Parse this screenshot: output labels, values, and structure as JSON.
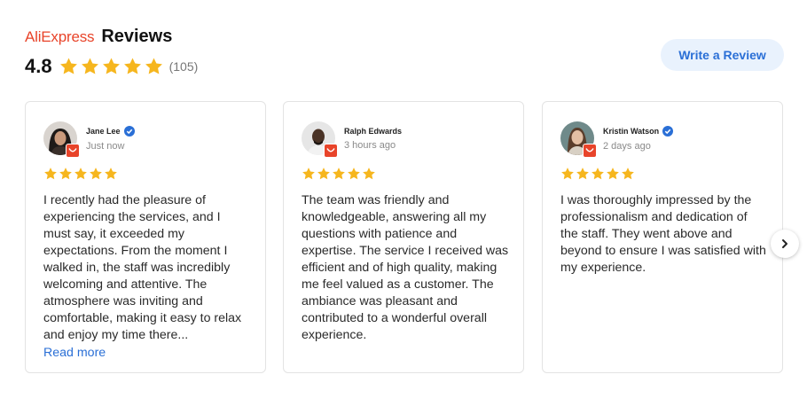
{
  "header": {
    "brand": "AliExpress",
    "title": "Reviews",
    "average_rating": "4.8",
    "stars": 5,
    "review_count": "(105)"
  },
  "write_review_label": "Write a Review",
  "colors": {
    "brand": "#e8442a",
    "star": "#f6b61e",
    "link": "#2a6fd6",
    "verified": "#2a6fd6"
  },
  "reviews": [
    {
      "author": "Jane Lee",
      "verified": true,
      "time": "Just now",
      "rating": 5,
      "text": "I recently had the pleasure of experiencing the services, and I must say, it exceeded my expectations. From the moment I walked in, the staff was incredibly welcoming and attentive. The atmosphere was inviting and comfortable, making it easy to relax and enjoy my time there...",
      "read_more": "Read more"
    },
    {
      "author": "Ralph Edwards",
      "verified": false,
      "time": "3 hours ago",
      "rating": 5,
      "text": "The team was friendly and knowledgeable, answering all my questions with patience and expertise. The service I received was efficient and of high quality, making me feel valued as a customer. The ambiance was pleasant and contributed to a wonderful overall experience."
    },
    {
      "author": "Kristin Watson",
      "verified": true,
      "time": "2 days ago",
      "rating": 5,
      "text": "I was thoroughly impressed by the professionalism and dedication of the staff. They went above and beyond to ensure I was satisfied with my experience."
    }
  ]
}
